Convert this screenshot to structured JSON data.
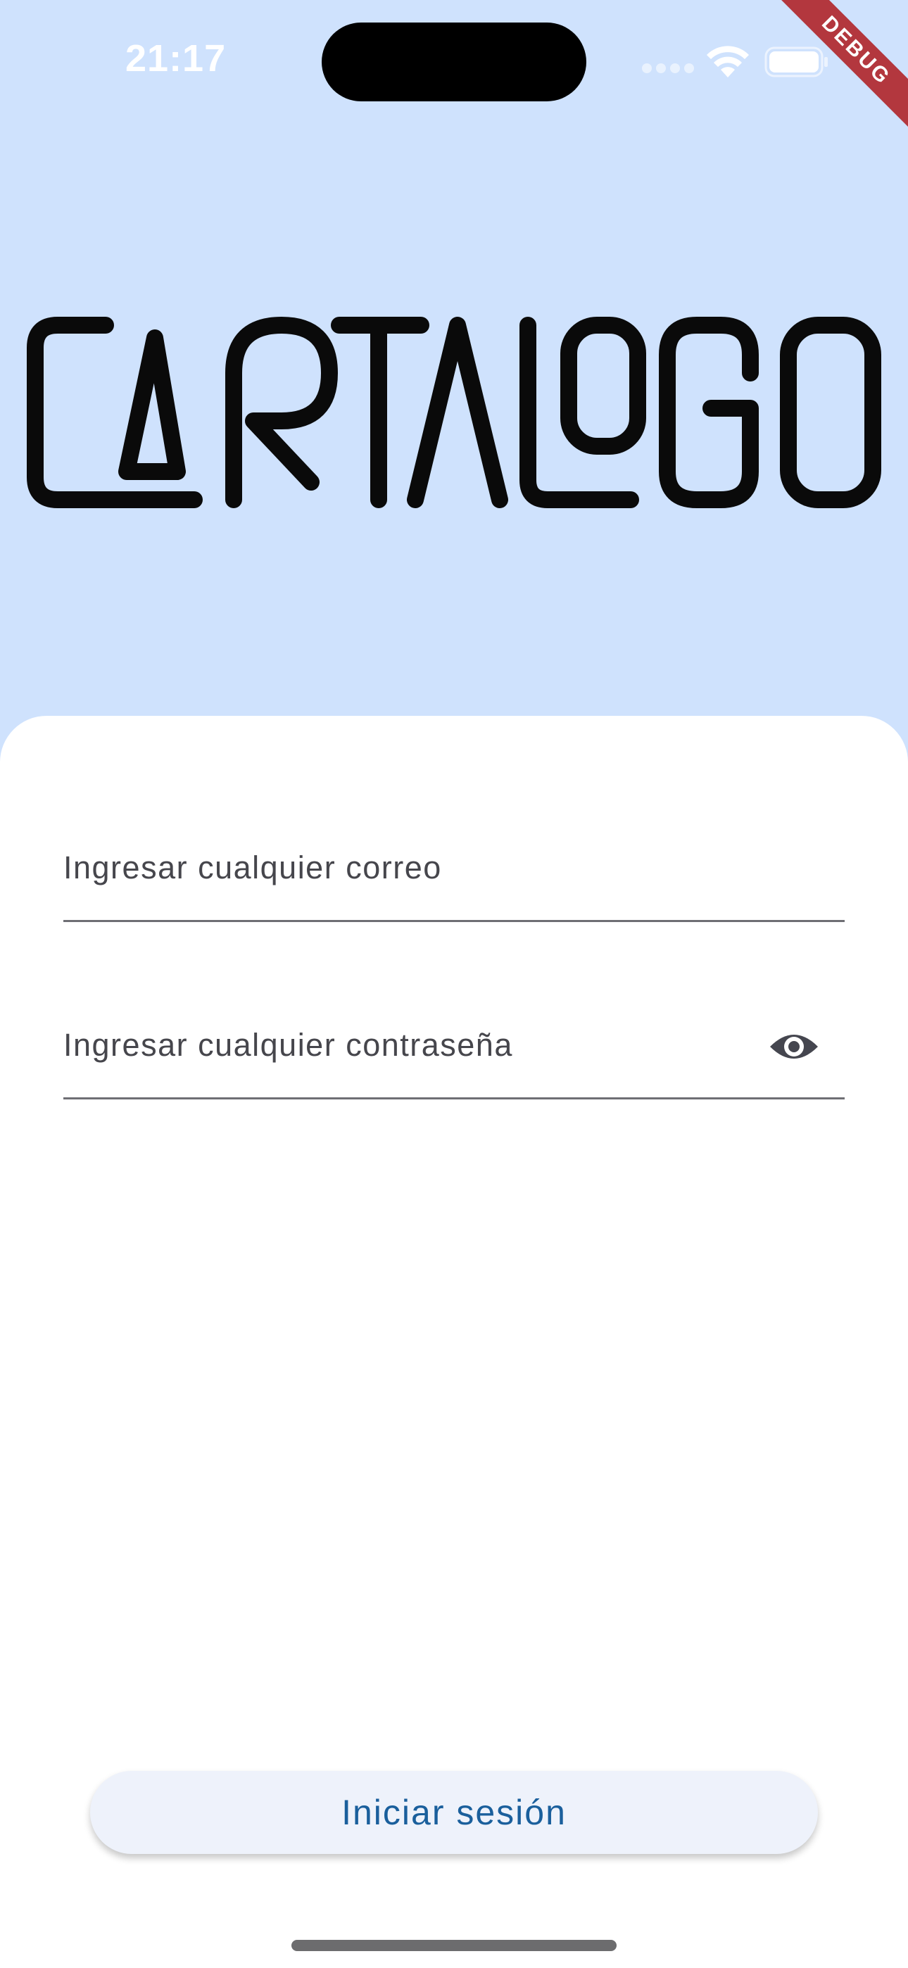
{
  "status_bar": {
    "time": "21:17",
    "icons": [
      "signal-icon",
      "wifi-icon",
      "battery-icon"
    ]
  },
  "debug_banner": {
    "label": "DEBUG"
  },
  "logo": {
    "text": "CARTALOGO"
  },
  "login_form": {
    "email_placeholder": "Ingresar cualquier correo",
    "password_placeholder": "Ingresar cualquier contraseña",
    "visibility_toggle_icon": "eye-icon",
    "submit_label": "Iniciar sesión"
  },
  "colors": {
    "header_background": "#cfe2fd",
    "sheet_background": "#ffffff",
    "button_text": "#1a5f9c",
    "button_background": "#eef2fb",
    "debug_banner": "#b3373e"
  }
}
